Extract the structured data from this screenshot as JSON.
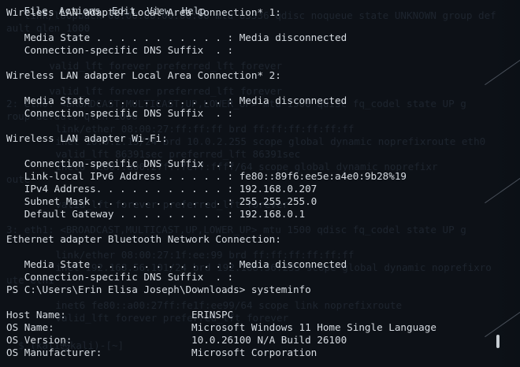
{
  "menu": [
    "File",
    "Actions",
    "Edit",
    "View",
    "Help"
  ],
  "ghost_lines": [
    "   link/loopback 00:00:00:00:00:00 mtu 65536 qdisc noqueue state UNKNOWN group def",
    "ault qlen 1000",
    "    valid_lft forever preferred_lft forever",
    "    valid_lft forever preferred_lft forever",
    "2: eth0: <BROADCAST,MULTICAST,UP,LOWER_UP> mtu 1500 qdisc fq_codel state UP g",
    "roup default qlen 1000",
    "    link/ether 08:00:27:ff:ff:ff brd ff:ff:ff:ff:ff:ff",
    "    inet 10.0.2.15/24 brd 10.0.2.255 scope global dynamic noprefixroute eth0",
    "    valid_lft 86391sec preferred_lft 86391sec",
    "    inet6 fe80::a00:27ff:feff:ffff/64 scope global dynamic noprefixr",
    "oute",
    "    valid_lft forever preferred_lft forever",
    "3: eth1: <BROADCAST,MULTICAST,UP,LOWER_UP> mtu 1500 qdisc fq_codel state UP g",
    "    link/ether 08:00:27:1f:ee:99 brd ff:ff:ff:ff:ff:ff",
    "    inet 192.168.56.101/24 brd 192.168.56.255 scope global dynamic noprefixro",
    "ute eth1",
    "    inet6 fe80::a00:27ff:fe1f:ee99/64 scope link noprefixroute",
    "    valid_lft forever preferred_lft forever",
    "  $ (kali㉿kali)-[~]"
  ],
  "lines": [
    "Wireless LAN adapter Local Area Connection* 1:",
    "",
    "   Media State . . . . . . . . . . . : Media disconnected",
    "   Connection-specific DNS Suffix  . :",
    "",
    "Wireless LAN adapter Local Area Connection* 2:",
    "",
    "   Media State . . . . . . . . . . . : Media disconnected",
    "   Connection-specific DNS Suffix  . :",
    "",
    "Wireless LAN adapter Wi-Fi:",
    "",
    "   Connection-specific DNS Suffix  . :",
    "   Link-local IPv6 Address . . . . . : fe80::89f6:ee5e:a4e0:9b28%19",
    "   IPv4 Address. . . . . . . . . . . : 192.168.0.207",
    "   Subnet Mask . . . . . . . . . . . : 255.255.255.0",
    "   Default Gateway . . . . . . . . . : 192.168.0.1",
    "",
    "Ethernet adapter Bluetooth Network Connection:",
    "",
    "   Media State . . . . . . . . . . . : Media disconnected",
    "   Connection-specific DNS Suffix  . :",
    "PS C:\\Users\\Erin Elisa Joseph\\Downloads> systeminfo",
    "",
    "Host Name:                     ERINSPC",
    "OS Name:                       Microsoft Windows 11 Home Single Language",
    "OS Version:                    10.0.26100 N/A Build 26100",
    "OS Manufacturer:               Microsoft Corporation"
  ]
}
